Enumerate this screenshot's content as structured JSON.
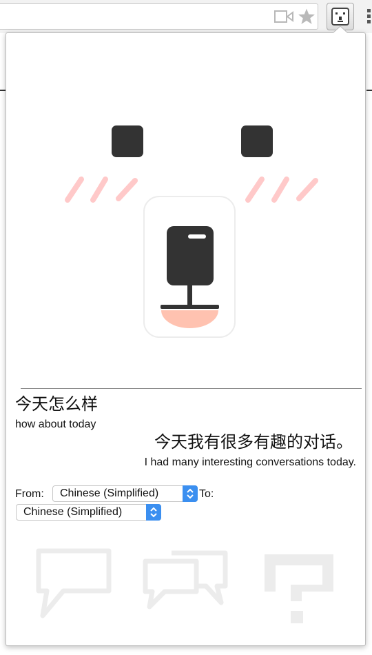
{
  "toolbar": {
    "camera_icon": "video-camera-icon",
    "star_icon": "star-icon",
    "extension_icon": "bear-extension-icon",
    "menu_icon": "kebab-menu-icon"
  },
  "colors": {
    "accent": "#3b8ff0",
    "blush": "#ffc9c9",
    "feature": "#333333",
    "mouth": "#ffc2b0",
    "ghost_icon": "#ececec"
  },
  "conversation": {
    "source": {
      "text": "今天怎么样",
      "translation": "how about today"
    },
    "reply": {
      "text": "今天我有很多有趣的对话。",
      "translation": "I had many interesting conversations today."
    }
  },
  "language": {
    "from_label": "From:",
    "from_value": "Chinese (Simplified)",
    "to_label": "To:",
    "to_value": "Chinese (Simplified)"
  },
  "bottom_icons": [
    "single-speech-bubble-icon",
    "double-speech-bubble-icon",
    "question-mark-icon"
  ]
}
